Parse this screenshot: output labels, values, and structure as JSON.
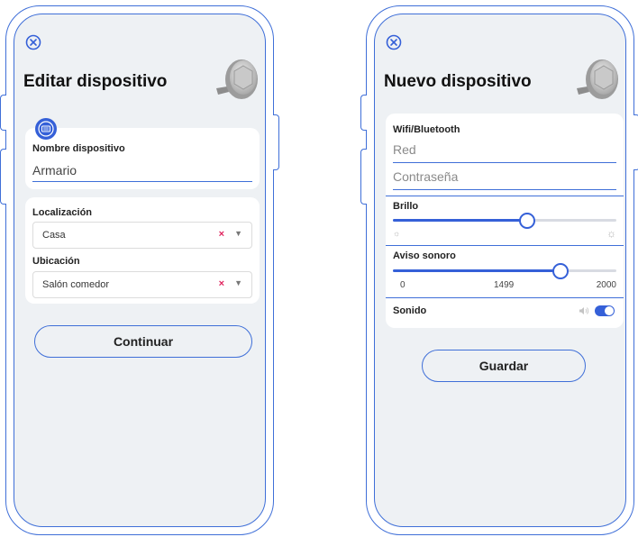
{
  "left": {
    "title": "Editar dispositivo",
    "name_label": "Nombre dispositivo",
    "name_value": "Armario",
    "localizacion_label": "Localización",
    "localizacion_value": "Casa",
    "ubicacion_label": "Ubicación",
    "ubicacion_value": "Salón comedor",
    "continue_label": "Continuar"
  },
  "right": {
    "title": "Nuevo dispositivo",
    "wifi_label": "Wifi/Bluetooth",
    "red_placeholder": "Red",
    "password_placeholder": "Contraseña",
    "brillo_label": "Brillo",
    "brillo_level": 0.6,
    "aviso_label": "Aviso sonoro",
    "aviso_min": "0",
    "aviso_mid": "1499",
    "aviso_max": "2000",
    "aviso_value": 1499,
    "sonido_label": "Sonido",
    "sonido_on": true,
    "save_label": "Guardar"
  },
  "icons": {
    "close": "close-circle-icon",
    "clear": "×",
    "dropdown": "▼",
    "brightness_low": "sun-small-icon",
    "brightness_high": "sun-large-icon",
    "speaker": "speaker-icon"
  },
  "colors": {
    "accent": "#3560d8",
    "outline": "#3f6fd8",
    "clear": "#e0245e",
    "screen_bg": "#eef1f4"
  }
}
